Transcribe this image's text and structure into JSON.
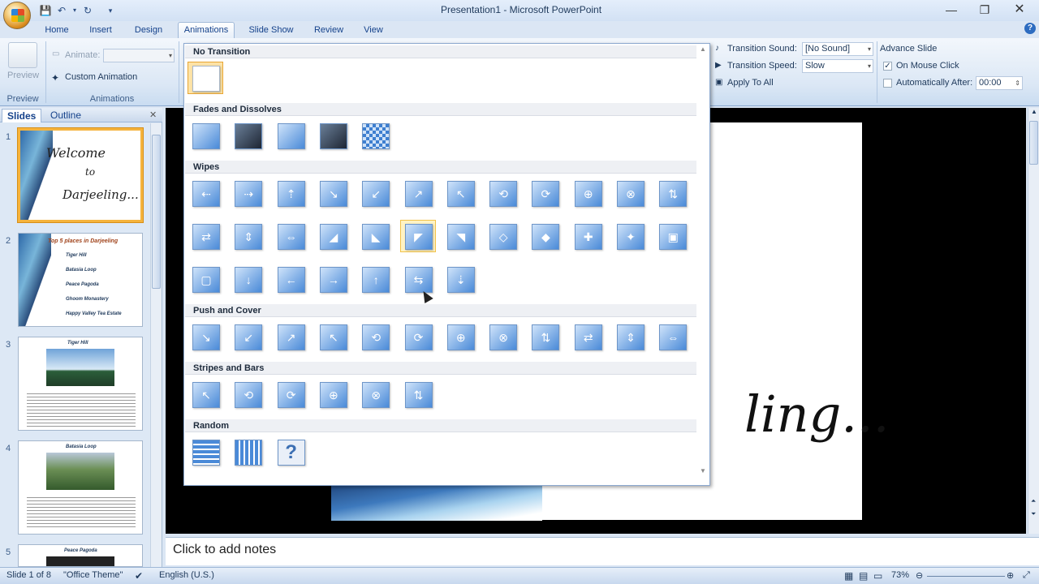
{
  "window": {
    "title": "Presentation1 - Microsoft PowerPoint"
  },
  "quick_access": [
    "save-icon",
    "undo-icon",
    "redo-icon",
    "customize-icon"
  ],
  "tabs": [
    "Home",
    "Insert",
    "Design",
    "Animations",
    "Slide Show",
    "Review",
    "View"
  ],
  "active_tab": "Animations",
  "ribbon": {
    "preview": {
      "button": "Preview",
      "group": "Preview"
    },
    "animations": {
      "animate_label": "Animate:",
      "animate_value": "",
      "custom_animation": "Custom Animation",
      "group": "Animations"
    },
    "transition": {
      "sound_label": "Transition Sound:",
      "sound_value": "[No Sound]",
      "speed_label": "Transition Speed:",
      "speed_value": "Slow",
      "apply_all": "Apply To All"
    },
    "advance": {
      "title": "Advance Slide",
      "on_click": "On Mouse Click",
      "on_click_checked": true,
      "auto_after": "Automatically After:",
      "auto_after_checked": false,
      "auto_value": "00:00"
    }
  },
  "left_pane": {
    "tabs": [
      "Slides",
      "Outline"
    ],
    "active_tab": "Slides",
    "slides": [
      {
        "num": "1",
        "lines": [
          "Welcome",
          "to",
          "Darjeeling..."
        ],
        "selected": true
      },
      {
        "num": "2",
        "lines": [
          "Top 5 places in Darjeeling",
          "Tiger Hill",
          "Batasia Loop",
          "Peace Pagoda",
          "Ghoom Monastery",
          "Happy Valley Tea Estate"
        ],
        "selected": false
      },
      {
        "num": "3",
        "lines": [
          "Tiger Hill"
        ],
        "selected": false
      },
      {
        "num": "4",
        "lines": [
          "Batasia Loop"
        ],
        "selected": false
      },
      {
        "num": "5",
        "lines": [
          "Peace Pagoda"
        ],
        "selected": false
      }
    ]
  },
  "slide_text": "ling...",
  "notes_placeholder": "Click to add notes",
  "status": {
    "slide": "Slide 1 of 8",
    "theme": "\"Office Theme\"",
    "language": "English (U.S.)",
    "zoom": "73%"
  },
  "gallery": {
    "sections": [
      {
        "title": "No Transition",
        "count": 1
      },
      {
        "title": "Fades and Dissolves",
        "count": 5
      },
      {
        "title": "Wipes",
        "count": 31
      },
      {
        "title": "Push and Cover",
        "count": 12
      },
      {
        "title": "Stripes and Bars",
        "count": 6
      },
      {
        "title": "Random",
        "count": 3
      }
    ]
  },
  "colors": {
    "accent": "#f5b33c",
    "ribbon": "#dbe7f5",
    "tile": "#4a8ad8"
  }
}
